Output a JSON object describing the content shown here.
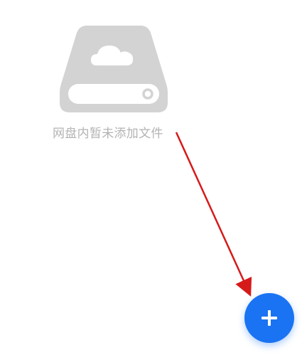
{
  "empty_state": {
    "icon": "cloud-drive-icon",
    "message": "网盘内暂未添加文件"
  },
  "fab": {
    "icon": "plus-icon"
  },
  "annotation": {
    "arrow_color": "#d61a1a"
  },
  "colors": {
    "fab": "#1a73f2",
    "empty_icon": "#d3d3d3",
    "empty_text": "#b3b3b3"
  }
}
